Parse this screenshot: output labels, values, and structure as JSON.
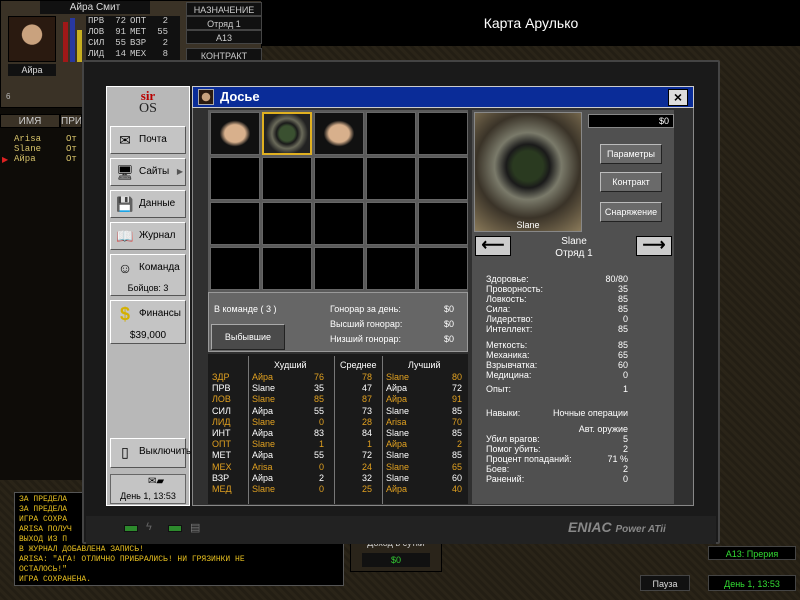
{
  "merc": {
    "top_name": "Айра Смит",
    "label": "Айра",
    "small_num": "6",
    "stats": [
      [
        "ПРВ",
        "72",
        "ОПТ",
        "2"
      ],
      [
        "ЛОВ",
        "91",
        "МЕТ",
        "55"
      ],
      [
        "СИЛ",
        "55",
        "ВЗР",
        "2"
      ],
      [
        "ЛИД",
        "14",
        "МЕХ",
        "8"
      ]
    ],
    "assignment_header": "НАЗНАЧЕНИЕ",
    "squad": "Отряд 1",
    "sector": "A13",
    "contract": "КОНТРАКТ"
  },
  "map_title": "Карта Арулько",
  "team_list": {
    "col_name": "ИМЯ",
    "col_assign": "ПРИ",
    "rows": [
      {
        "name": "Arisa",
        "assign": "От"
      },
      {
        "name": "Slane",
        "assign": "От"
      },
      {
        "name": "Айра",
        "assign": "От"
      }
    ]
  },
  "log_lines": [
    "ЗА ПРЕДЕЛА",
    "ЗА ПРЕДЕЛА",
    "ИГРА СОХРА",
    "ARISA ПОЛУЧ",
    "ВЫХОД ИЗ П",
    "В ЖУРНАЛ ДОБАВЛЕНА ЗАПИСЬ!",
    "ARISA: \"АГА! ОТЛИЧНО ПРИБРАЛИСЬ! НИ ГРЯЗИНКИ НЕ",
    "ОСТАЛОСЬ!\"",
    "ИГРА СОХРАНЕНА."
  ],
  "income": {
    "label": "Доход в сутки",
    "value": "$0"
  },
  "sector_box": "A13: Прерия",
  "pause": "Пауза",
  "clock": "День 1, 13:53",
  "os": {
    "logo_top": "sir",
    "logo_bottom": "OS",
    "buttons": [
      {
        "label": "Почта",
        "icon": "mail-icon",
        "glyph": "✉"
      },
      {
        "label": "Сайты",
        "icon": "computer-icon",
        "glyph": "🖥"
      },
      {
        "label": "Данные",
        "icon": "disk-icon",
        "glyph": "💾"
      },
      {
        "label": "Журнал",
        "icon": "book-icon",
        "glyph": "📖"
      },
      {
        "label": "Команда",
        "icon": "team-icon",
        "glyph": "☺"
      },
      {
        "label": "Финансы",
        "icon": "dollar-icon",
        "glyph": "$"
      }
    ],
    "boys": "Бойцов: 3",
    "finances": "$39,000",
    "shutdown": "Выключить",
    "date": "День 1, 13:53"
  },
  "dossier": {
    "title": "Досье",
    "close": "×",
    "in_team": "В команде ( 3 )",
    "fired": "Выбывшие",
    "fee_day_label": "Гонорар за день:",
    "fee_day_value": "$0",
    "fee_max_label": "Высший гонорар:",
    "fee_max_value": "$0",
    "fee_min_label": "Низший гонорар:",
    "fee_min_value": "$0",
    "headers": {
      "worst": "Худший",
      "avg": "Среднее",
      "best": "Лучший"
    },
    "rows": [
      {
        "stat": "ЗДР",
        "worst": "Айра",
        "wv": "76",
        "avg": "78",
        "best": "Slane",
        "bv": "80",
        "hl": true
      },
      {
        "stat": "ПРВ",
        "worst": "Slane",
        "wv": "35",
        "avg": "47",
        "best": "Айра",
        "bv": "72",
        "hl": false
      },
      {
        "stat": "ЛОВ",
        "worst": "Slane",
        "wv": "85",
        "avg": "87",
        "best": "Айра",
        "bv": "91",
        "hl": true
      },
      {
        "stat": "СИЛ",
        "worst": "Айра",
        "wv": "55",
        "avg": "73",
        "best": "Slane",
        "bv": "85",
        "hl": false
      },
      {
        "stat": "ЛИД",
        "worst": "Slane",
        "wv": "0",
        "avg": "28",
        "best": "Arisa",
        "bv": "70",
        "hl": true
      },
      {
        "stat": "ИНТ",
        "worst": "Айра",
        "wv": "83",
        "avg": "84",
        "best": "Slane",
        "bv": "85",
        "hl": false
      },
      {
        "stat": "ОПТ",
        "worst": "Slane",
        "wv": "1",
        "avg": "1",
        "best": "Айра",
        "bv": "2",
        "hl": true
      },
      {
        "stat": "МЕТ",
        "worst": "Айра",
        "wv": "55",
        "avg": "72",
        "best": "Slane",
        "bv": "85",
        "hl": false
      },
      {
        "stat": "МЕХ",
        "worst": "Arisa",
        "wv": "0",
        "avg": "24",
        "best": "Slane",
        "bv": "65",
        "hl": true
      },
      {
        "stat": "ВЗР",
        "worst": "Айра",
        "wv": "2",
        "avg": "32",
        "best": "Slane",
        "bv": "60",
        "hl": false
      },
      {
        "stat": "МЕД",
        "worst": "Slane",
        "wv": "0",
        "avg": "25",
        "best": "Айра",
        "bv": "40",
        "hl": true
      }
    ],
    "money": "$0",
    "btn_params": "Параметры",
    "btn_contract": "Контракт",
    "btn_gear": "Снаряжение",
    "portrait_name": "Slane",
    "name": "Slane",
    "squad": "Отряд 1",
    "attrs": [
      {
        "label": "Здоровье:",
        "value": "80/80"
      },
      {
        "label": "Проворность:",
        "value": "35"
      },
      {
        "label": "Ловкость:",
        "value": "85"
      },
      {
        "label": "Сила:",
        "value": "85"
      },
      {
        "label": "Лидерство:",
        "value": "0"
      },
      {
        "label": "Интеллект:",
        "value": "85"
      },
      {
        "label": "Меткость:",
        "value": "85"
      },
      {
        "label": "Механика:",
        "value": "65"
      },
      {
        "label": "Взрывчатка:",
        "value": "60"
      },
      {
        "label": "Медицина:",
        "value": "0"
      },
      {
        "label": "Опыт:",
        "value": "1"
      },
      {
        "label": "Навыки:",
        "value": "Ночные операции"
      },
      {
        "label": "",
        "value": "Авт. оружие"
      },
      {
        "label": "Убил врагов:",
        "value": "5"
      },
      {
        "label": "Помог убить:",
        "value": "2"
      },
      {
        "label": "Процент попаданий:",
        "value": "71 %"
      },
      {
        "label": "Боев:",
        "value": "2"
      },
      {
        "label": "Ранений:",
        "value": "0"
      }
    ]
  },
  "laptop_brand": "ENIAC",
  "laptop_model": "Power ATii"
}
